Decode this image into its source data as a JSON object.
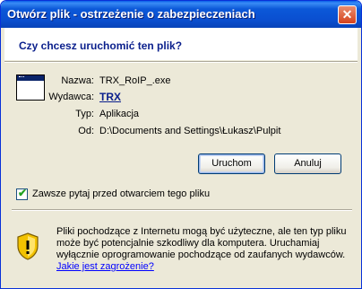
{
  "window": {
    "title": "Otwórz plik - ostrzeżenie o zabezpieczeniach",
    "close_glyph": "✕"
  },
  "header": {
    "question": "Czy chcesz uruchomić ten plik?"
  },
  "file_info": {
    "icon": "application-window-icon",
    "rows": [
      {
        "label": "Nazwa:",
        "value": "TRX_RoIP_.exe"
      },
      {
        "label": "Wydawca:",
        "value": "TRX"
      },
      {
        "label": "Typ:",
        "value": "Aplikacja"
      },
      {
        "label": "Od:",
        "value": "D:\\Documents and Settings\\Łukasz\\Pulpit"
      }
    ]
  },
  "buttons": {
    "run": "Uruchom",
    "cancel": "Anuluj"
  },
  "checkbox": {
    "checked": true,
    "label": "Zawsze pytaj przed otwarciem tego pliku"
  },
  "warning": {
    "icon": "security-shield-warning-icon",
    "text": "Pliki pochodzące z Internetu mogą być użyteczne, ale ten typ pliku może być potencjalnie szkodliwy dla komputera. Uruchamiaj wyłącznie oprogramowanie pochodzące od zaufanych wydawców.",
    "link": "Jakie jest zagrożenie?"
  },
  "colors": {
    "titlebar": "#0a4fd0",
    "dialog_bg": "#ece9d8",
    "header_text": "#0a1f8c",
    "link": "#0000ff"
  }
}
